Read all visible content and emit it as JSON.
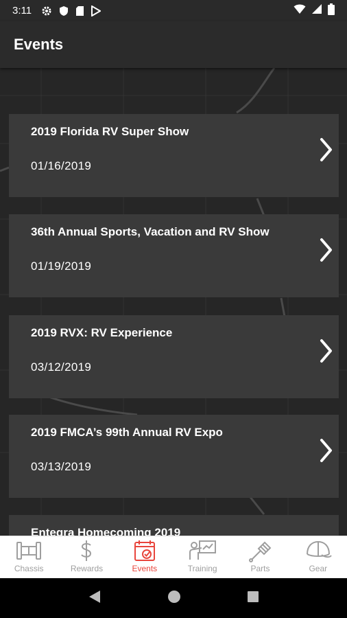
{
  "status_bar": {
    "time": "3:11",
    "left_icons": [
      "gear-icon",
      "shield-icon",
      "sd-card-icon",
      "play-store-icon"
    ],
    "right_icons": [
      "wifi-icon",
      "signal-icon",
      "battery-icon"
    ]
  },
  "app_bar": {
    "title": "Events"
  },
  "events": [
    {
      "title": "2019 Florida RV Super Show",
      "date": "01/16/2019"
    },
    {
      "title": "36th Annual Sports, Vacation and RV Show",
      "date": "01/19/2019"
    },
    {
      "title": "2019 RVX: RV Experience",
      "date": "03/12/2019"
    },
    {
      "title": "2019 FMCA’s 99th Annual RV Expo",
      "date": "03/13/2019"
    },
    {
      "title": "Entegra Homecoming 2019",
      "date": ""
    }
  ],
  "tabs": [
    {
      "label": "Chassis",
      "icon": "chassis-icon",
      "active": false
    },
    {
      "label": "Rewards",
      "icon": "dollar-icon",
      "active": false
    },
    {
      "label": "Events",
      "icon": "calendar-check-icon",
      "active": true
    },
    {
      "label": "Training",
      "icon": "presentation-icon",
      "active": false
    },
    {
      "label": "Parts",
      "icon": "wrench-icon",
      "active": false
    },
    {
      "label": "Gear",
      "icon": "cap-icon",
      "active": false
    }
  ],
  "colors": {
    "accent": "#e8453c",
    "inactive_tab": "#9e9e9e",
    "card": "#3a3a3a",
    "background": "#262626"
  }
}
